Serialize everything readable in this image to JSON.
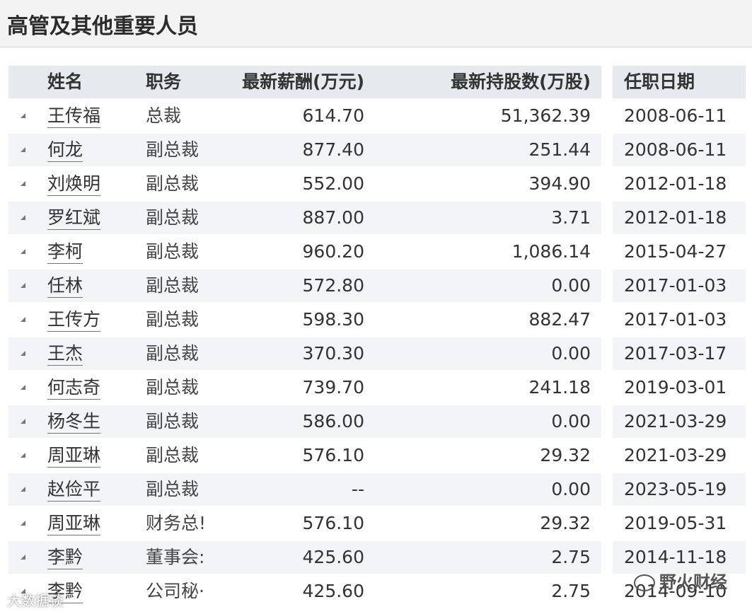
{
  "header": {
    "title": "高管及其他重要人员"
  },
  "table": {
    "columns": [
      "姓名",
      "职务",
      "最新薪酬(万元)",
      "最新持股数(万股)",
      "任职日期"
    ],
    "rows": [
      [
        "王传福",
        "总裁",
        "614.70",
        "51,362.39",
        "2008-06-11"
      ],
      [
        "何龙",
        "副总裁",
        "877.40",
        "251.44",
        "2008-06-11"
      ],
      [
        "刘焕明",
        "副总裁",
        "552.00",
        "394.90",
        "2012-01-18"
      ],
      [
        "罗红斌",
        "副总裁",
        "887.00",
        "3.71",
        "2012-01-18"
      ],
      [
        "李柯",
        "副总裁",
        "960.20",
        "1,086.14",
        "2015-04-27"
      ],
      [
        "任林",
        "副总裁",
        "572.80",
        "0.00",
        "2017-01-03"
      ],
      [
        "王传方",
        "副总裁",
        "598.30",
        "882.47",
        "2017-01-03"
      ],
      [
        "王杰",
        "副总裁",
        "370.30",
        "0.00",
        "2017-03-17"
      ],
      [
        "何志奇",
        "副总裁",
        "739.70",
        "241.18",
        "2019-03-01"
      ],
      [
        "杨冬生",
        "副总裁",
        "586.00",
        "0.00",
        "2021-03-29"
      ],
      [
        "周亚琳",
        "副总裁",
        "576.10",
        "29.32",
        "2021-03-29"
      ],
      [
        "赵俭平",
        "副总裁",
        "--",
        "0.00",
        "2023-05-19"
      ],
      [
        "周亚琳",
        "财务总!",
        "576.10",
        "29.32",
        "2019-05-31"
      ],
      [
        "李黔",
        "董事会:",
        "425.60",
        "2.75",
        "2014-11-18"
      ],
      [
        "李黔",
        "公司秘·",
        "425.60",
        "2.75",
        "2014-09-10"
      ]
    ]
  },
  "watermarks": {
    "right": "野火财经",
    "left": "大数据谈"
  }
}
